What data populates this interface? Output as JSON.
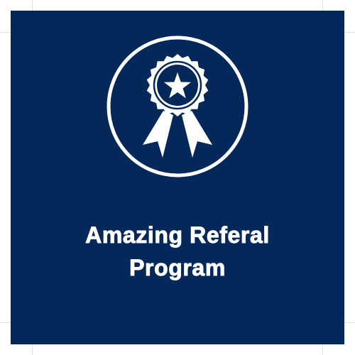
{
  "card": {
    "background": "#04285a",
    "foreground": "#ffffff",
    "icon": "award-ribbon-star-icon",
    "title_line1": "Amazing Referal",
    "title_line2": "Program"
  }
}
